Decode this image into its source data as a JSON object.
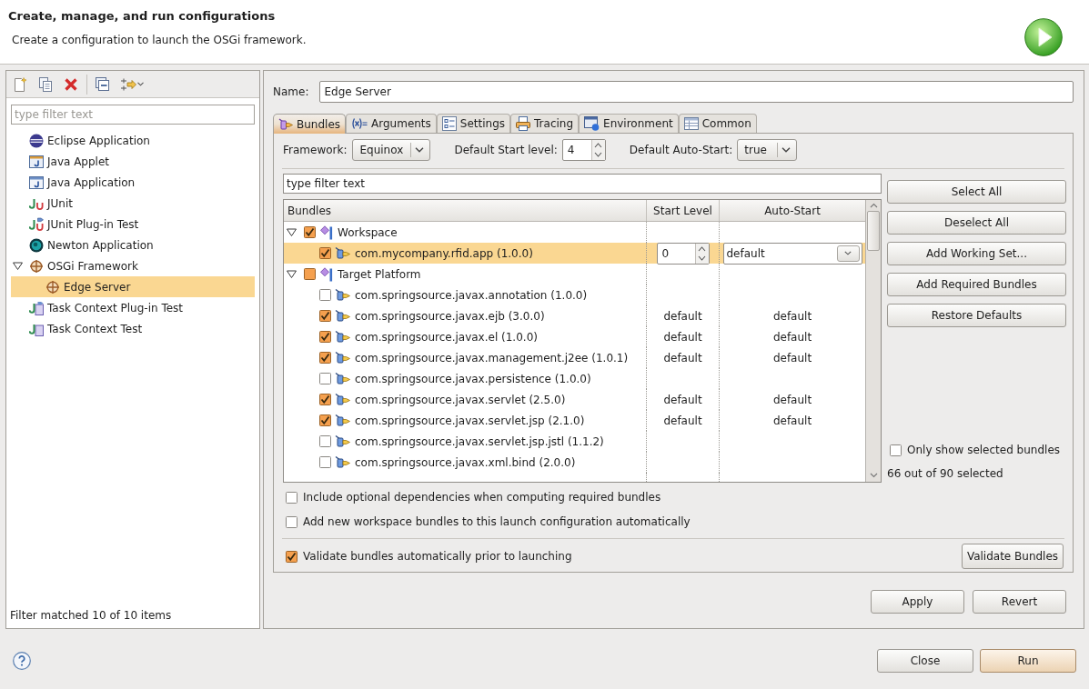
{
  "header": {
    "title": "Create, manage, and run configurations",
    "message": "Create a configuration to launch the OSGi framework."
  },
  "sidebar": {
    "filter": {
      "placeholder": "type filter text"
    },
    "items": [
      {
        "label": "Eclipse Application",
        "kind": "eclipse",
        "selected": false
      },
      {
        "label": "Java Applet",
        "kind": "applet",
        "selected": false
      },
      {
        "label": "Java Application",
        "kind": "java",
        "selected": false
      },
      {
        "label": "JUnit",
        "kind": "junit",
        "selected": false
      },
      {
        "label": "JUnit Plug-in Test",
        "kind": "pde-junit",
        "selected": false
      },
      {
        "label": "Newton Application",
        "kind": "newton",
        "selected": false
      },
      {
        "label": "OSGi Framework",
        "kind": "osgi",
        "selected": false,
        "expanded": true,
        "children": [
          {
            "label": "Edge Server",
            "kind": "osgi",
            "selected": true
          }
        ]
      },
      {
        "label": "Task Context Plug-in Test",
        "kind": "task-pde",
        "selected": false
      },
      {
        "label": "Task Context Test",
        "kind": "task",
        "selected": false
      }
    ],
    "status": "Filter matched 10 of 10 items"
  },
  "config": {
    "name": {
      "label": "Name:",
      "value": "Edge Server"
    },
    "tabs": [
      {
        "label": "Bundles",
        "kind": "bundles",
        "selected": true
      },
      {
        "label": "Arguments",
        "kind": "arguments",
        "selected": false
      },
      {
        "label": "Settings",
        "kind": "settings",
        "selected": false
      },
      {
        "label": "Tracing",
        "kind": "tracing",
        "selected": false
      },
      {
        "label": "Environment",
        "kind": "environment",
        "selected": false
      },
      {
        "label": "Common",
        "kind": "common",
        "selected": false
      }
    ],
    "framework": {
      "label": "Framework:",
      "value": "Equinox"
    },
    "start_level": {
      "label": "Default Start level:",
      "value": "4"
    },
    "auto_start": {
      "label": "Default Auto-Start:",
      "value": "true"
    },
    "filter": {
      "value": "type filter text"
    },
    "table": {
      "columns": [
        "Bundles",
        "Start Level",
        "Auto-Start"
      ],
      "rows": [
        {
          "label": "Workspace",
          "kind": "group",
          "expanded": true,
          "checked": true,
          "partial": false,
          "selected": false,
          "children": [
            {
              "label": "com.mycompany.rfid.app (1.0.0)",
              "kind": "bundle",
              "checked": true,
              "selected": true,
              "start_level": "0",
              "auto_start": "default"
            }
          ]
        },
        {
          "label": "Target Platform",
          "kind": "group",
          "expanded": true,
          "checked": true,
          "partial": true,
          "selected": false,
          "children": [
            {
              "label": "com.springsource.javax.annotation (1.0.0)",
              "kind": "bundle",
              "checked": false,
              "selected": false
            },
            {
              "label": "com.springsource.javax.ejb (3.0.0)",
              "kind": "bundle",
              "checked": true,
              "selected": false,
              "start_level": "default",
              "auto_start": "default"
            },
            {
              "label": "com.springsource.javax.el (1.0.0)",
              "kind": "bundle",
              "checked": true,
              "selected": false,
              "start_level": "default",
              "auto_start": "default"
            },
            {
              "label": "com.springsource.javax.management.j2ee (1.0.1)",
              "kind": "bundle",
              "checked": true,
              "selected": false,
              "start_level": "default",
              "auto_start": "default"
            },
            {
              "label": "com.springsource.javax.persistence (1.0.0)",
              "kind": "bundle",
              "checked": false,
              "selected": false
            },
            {
              "label": "com.springsource.javax.servlet (2.5.0)",
              "kind": "bundle",
              "checked": true,
              "selected": false,
              "start_level": "default",
              "auto_start": "default"
            },
            {
              "label": "com.springsource.javax.servlet.jsp (2.1.0)",
              "kind": "bundle",
              "checked": true,
              "selected": false,
              "start_level": "default",
              "auto_start": "default"
            },
            {
              "label": "com.springsource.javax.servlet.jsp.jstl (1.1.2)",
              "kind": "bundle",
              "checked": false,
              "selected": false
            },
            {
              "label": "com.springsource.javax.xml.bind (2.0.0)",
              "kind": "bundle",
              "checked": false,
              "selected": false
            }
          ]
        }
      ]
    },
    "bundle_buttons": [
      "Select All",
      "Deselect All",
      "Add Working Set...",
      "Add Required Bundles",
      "Restore Defaults"
    ],
    "only_selected": {
      "label": "Only show selected bundles",
      "checked": false
    },
    "count": "66 out of 90 selected",
    "options": [
      {
        "label": "Include optional dependencies when computing required bundles",
        "checked": false
      },
      {
        "label": "Add new workspace bundles to this launch configuration automatically",
        "checked": false
      }
    ],
    "validate": {
      "label": "Validate bundles automatically prior to launching",
      "checked": true
    },
    "validate_button": "Validate Bundles"
  },
  "actions": [
    "Apply",
    "Revert"
  ],
  "footer": [
    {
      "label": "Close",
      "default": false
    },
    {
      "label": "Run",
      "default": true
    }
  ]
}
